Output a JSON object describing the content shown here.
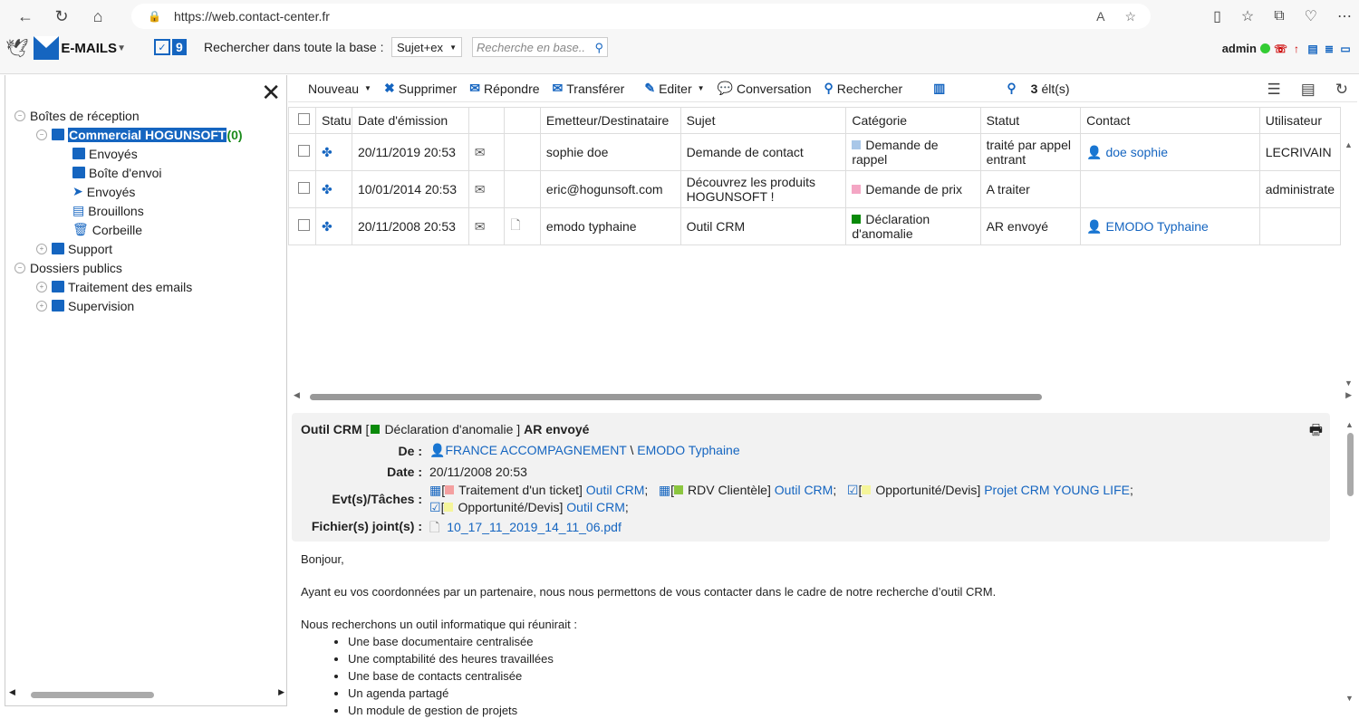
{
  "browser": {
    "url": "https://web.contact-center.fr"
  },
  "app": {
    "logo_text": "E-MAILS",
    "task_count": "9",
    "search_label": "Rechercher dans toute la base :",
    "search_scope": "Sujet+ex",
    "search_placeholder": "Recherche en base..",
    "user": "admin"
  },
  "tree": {
    "inbox_group": "Boîtes de réception",
    "commercial": "Commercial HOGUNSOFT",
    "commercial_count": "(0)",
    "sub": [
      "Envoyés",
      "Boîte d'envoi",
      "Envoyés",
      "Brouillons",
      "Corbeille"
    ],
    "support": "Support",
    "public": "Dossiers publics",
    "traitement": "Traitement des emails",
    "supervision": "Supervision"
  },
  "toolbar": {
    "nouveau": "Nouveau",
    "supprimer": "Supprimer",
    "repondre": "Répondre",
    "transferer": "Transférer",
    "editer": "Editer",
    "conversation": "Conversation",
    "rechercher": "Rechercher",
    "count_num": "3",
    "count_unit": "élt(s)"
  },
  "table": {
    "headers": [
      "Statu",
      "Date d'émission",
      "",
      "",
      "Emetteur/Destinataire",
      "Sujet",
      "Catégorie",
      "Statut",
      "Contact",
      "Utilisateur"
    ],
    "rows": [
      {
        "date": "20/11/2019 20:53",
        "from": "sophie doe",
        "subject": "Demande de contact",
        "category": "Demande de rappel",
        "cat_color": "#a9c7e8",
        "status": "traité par appel entrant",
        "contact": "doe sophie",
        "user": "LECRIVAIN",
        "attach": ""
      },
      {
        "date": "10/01/2014 20:53",
        "from": "eric@hogunsoft.com",
        "subject": "Découvrez les produits HOGUNSOFT !",
        "category": "Demande de prix",
        "cat_color": "#f4a6c4",
        "status": "A traiter",
        "contact": "",
        "user": "administrate",
        "attach": ""
      },
      {
        "date": "20/11/2008 20:53",
        "from": "emodo typhaine",
        "subject": "Outil CRM",
        "category": "Déclaration d'anomalie",
        "cat_color": "#0a8a0a",
        "status": "AR envoyé",
        "contact": "EMODO Typhaine",
        "user": "",
        "attach": "yes"
      }
    ]
  },
  "detail": {
    "subject": "Outil CRM",
    "category": "Déclaration d'anomalie",
    "status": "AR envoyé",
    "de_label": "De :",
    "de_company": "FRANCE ACCOMPAGNEMENT",
    "de_sep": "\\",
    "de_person": "EMODO Typhaine",
    "date_label": "Date :",
    "date": "20/11/2008 20:53",
    "evt_label": "Evt(s)/Tâches :",
    "evt1_type": "Traitement d'un ticket]",
    "evt1_link": "Outil CRM",
    "evt2_type": "RDV Clientèle]",
    "evt2_link": "Outil CRM",
    "evt3_type": "Opportunité/Devis]",
    "evt3_link": "Projet CRM YOUNG LIFE",
    "evt4_type": "Opportunité/Devis]",
    "evt4_link": "Outil CRM",
    "files_label": "Fichier(s) joint(s) :",
    "file": "10_17_11_2019_14_11_06.pdf"
  },
  "body": {
    "greeting": "Bonjour,",
    "p1": "Ayant eu vos coordonnées par un partenaire, nous nous permettons de vous contacter dans le cadre de notre recherche d’outil CRM.",
    "p2": "Nous recherchons un outil informatique qui réunirait :",
    "items": [
      "Une base documentaire centralisée",
      "Une comptabilité des heures travaillées",
      "Une base de contacts centralisée",
      "Un agenda partagé",
      "Un module de gestion de projets"
    ]
  }
}
